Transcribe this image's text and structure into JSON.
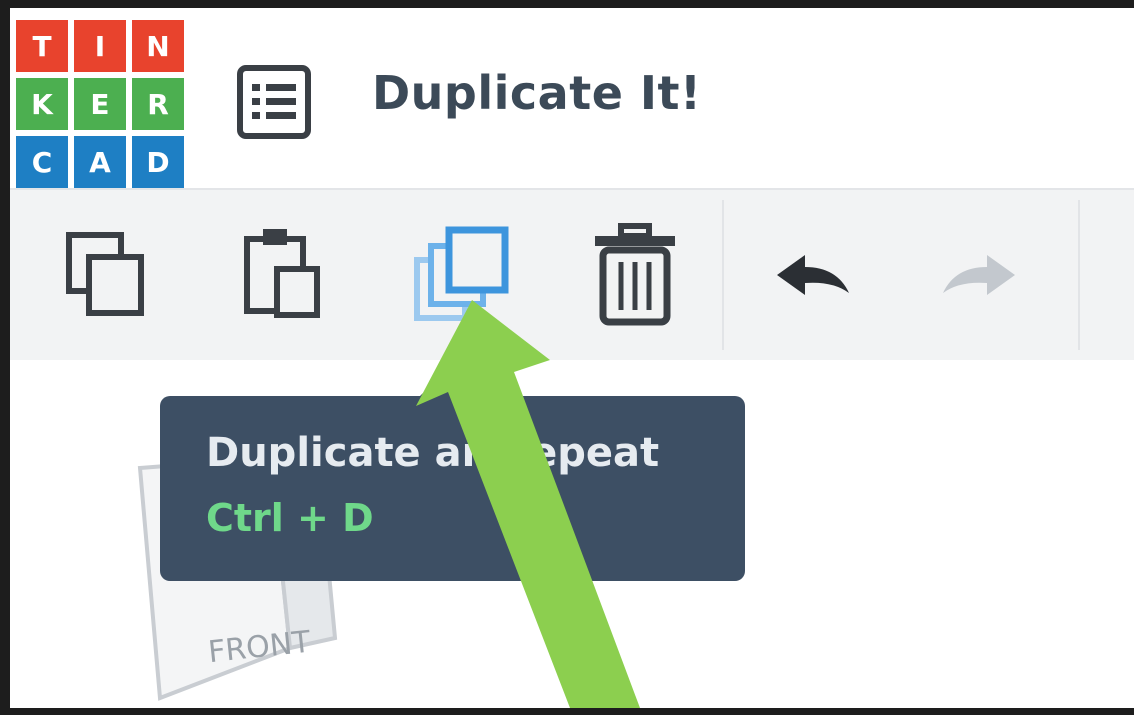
{
  "app": {
    "logo": {
      "rows": [
        [
          {
            "letter": "T",
            "color": "#e8432d"
          },
          {
            "letter": "I",
            "color": "#e8432d"
          },
          {
            "letter": "N",
            "color": "#e8432d"
          }
        ],
        [
          {
            "letter": "K",
            "color": "#4caf50"
          },
          {
            "letter": "E",
            "color": "#4caf50"
          },
          {
            "letter": "R",
            "color": "#4caf50"
          }
        ],
        [
          {
            "letter": "C",
            "color": "#1e7fc4"
          },
          {
            "letter": "A",
            "color": "#1e7fc4"
          },
          {
            "letter": "D",
            "color": "#1e7fc4"
          }
        ]
      ]
    },
    "project_title": "Duplicate It!",
    "menu_icon": "list-menu-icon"
  },
  "toolbar": {
    "tools": [
      {
        "name": "copy-button",
        "icon": "copy-icon",
        "highlighted": false
      },
      {
        "name": "paste-button",
        "icon": "paste-icon",
        "highlighted": false
      },
      {
        "name": "duplicate-button",
        "icon": "duplicate-icon",
        "highlighted": true
      },
      {
        "name": "delete-button",
        "icon": "trash-icon",
        "highlighted": false
      },
      {
        "name": "undo-button",
        "icon": "undo-arrow-icon",
        "enabled": true
      },
      {
        "name": "redo-button",
        "icon": "redo-arrow-icon",
        "enabled": false
      }
    ],
    "accent_color": "#4a9fe0"
  },
  "tooltip": {
    "title": "Duplicate an  epeat",
    "shortcut": "Ctrl + D"
  },
  "view_cube": {
    "face_label": "FRONT"
  },
  "annotation": {
    "arrow_color": "#8ccf4f",
    "icon": "pointer-arrow-icon"
  }
}
